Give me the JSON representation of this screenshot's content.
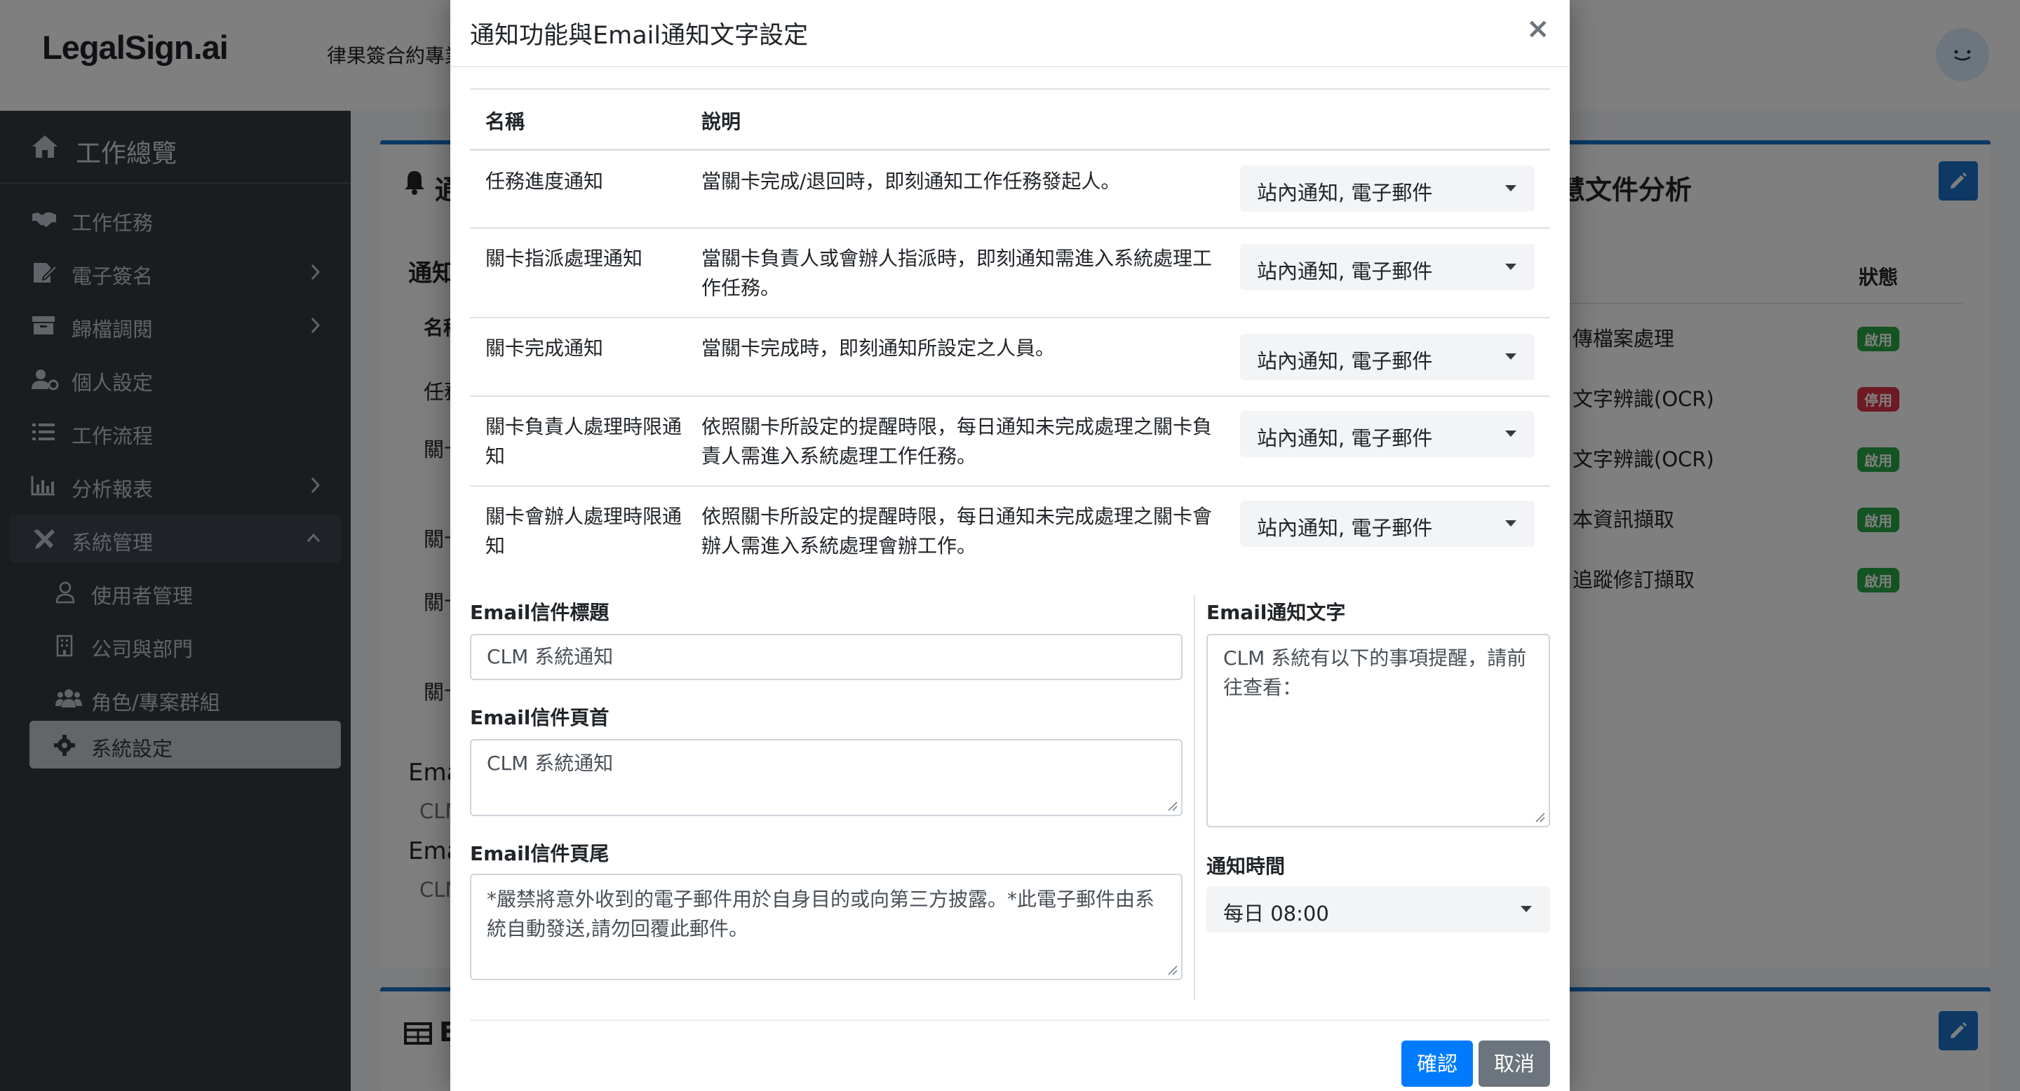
{
  "header": {
    "logo": "LegalSign.ai",
    "tagline": "律果簽合約專業"
  },
  "sidebar": {
    "home": "工作總覽",
    "items": [
      {
        "label": "工作任務",
        "icon": "handshake-icon"
      },
      {
        "label": "電子簽名",
        "icon": "signature-icon"
      },
      {
        "label": "歸檔調閱",
        "icon": "archive-icon"
      },
      {
        "label": "個人設定",
        "icon": "user-cog-icon"
      },
      {
        "label": "工作流程",
        "icon": "list-icon"
      },
      {
        "label": "分析報表",
        "icon": "bar-chart-icon"
      },
      {
        "label": "系統管理",
        "icon": "tools-icon"
      }
    ],
    "sub_items": [
      {
        "label": "使用者管理",
        "icon": "user-icon"
      },
      {
        "label": "公司與部門",
        "icon": "building-icon"
      },
      {
        "label": "角色/專案群組",
        "icon": "users-icon"
      },
      {
        "label": "系統設定",
        "icon": "gear-icon"
      }
    ]
  },
  "background": {
    "card1_title": "通",
    "card1_subtitle": "通知",
    "col_name": "名稱",
    "rows": [
      "任務",
      "關卡",
      "關卡",
      "關卡限",
      "關卡限"
    ],
    "email_labels": [
      "Ema",
      "Ema"
    ],
    "email_values": [
      "CLM",
      "CLM"
    ],
    "card2_title": "慧文件分析",
    "status_header": "狀態",
    "analysis_rows": [
      {
        "name": "傳檔案處理",
        "status": "啟用"
      },
      {
        "name": "文字辨識(OCR)",
        "status": "停用"
      },
      {
        "name": "文字辨識(OCR)",
        "status": "啟用"
      },
      {
        "name": "本資訊擷取",
        "status": "啟用"
      },
      {
        "name": "追蹤修訂擷取",
        "status": "啟用"
      }
    ],
    "card3_title": "E"
  },
  "modal": {
    "title": "通知功能與Email通知文字設定",
    "close": "×",
    "table": {
      "headers": [
        "名稱",
        "說明"
      ],
      "rows": [
        {
          "name": "任務進度通知",
          "desc": "當關卡完成/退回時，即刻通知工作任務發起人。",
          "value": "站內通知, 電子郵件"
        },
        {
          "name": "關卡指派處理通知",
          "desc": "當關卡負責人或會辦人指派時，即刻通知需進入系統處理工作任務。",
          "value": "站內通知, 電子郵件"
        },
        {
          "name": "關卡完成通知",
          "desc": "當關卡完成時，即刻通知所設定之人員。",
          "value": "站內通知, 電子郵件"
        },
        {
          "name": "關卡負責人處理時限通知",
          "desc": "依照關卡所設定的提醒時限，每日通知未完成處理之關卡負責人需進入系統處理工作任務。",
          "value": "站內通知, 電子郵件"
        },
        {
          "name": "關卡會辦人處理時限通知",
          "desc": "依照關卡所設定的提醒時限，每日通知未完成處理之關卡會辦人需進入系統處理會辦工作。",
          "value": "站內通知, 電子郵件"
        }
      ]
    },
    "email_subject": {
      "label": "Email信件標題",
      "value": "CLM 系統通知"
    },
    "email_header": {
      "label": "Email信件頁首",
      "value": "CLM 系統通知"
    },
    "email_footer": {
      "label": "Email信件頁尾",
      "value": "*嚴禁將意外收到的電子郵件用於自身目的或向第三方披露。*此電子郵件由系統自動發送,請勿回覆此郵件。"
    },
    "email_text": {
      "label": "Email通知文字",
      "value": "CLM 系統有以下的事項提醒，請前往查看："
    },
    "notify_time": {
      "label": "通知時間",
      "value": "每日 08:00"
    },
    "confirm": "確認",
    "cancel": "取消"
  }
}
